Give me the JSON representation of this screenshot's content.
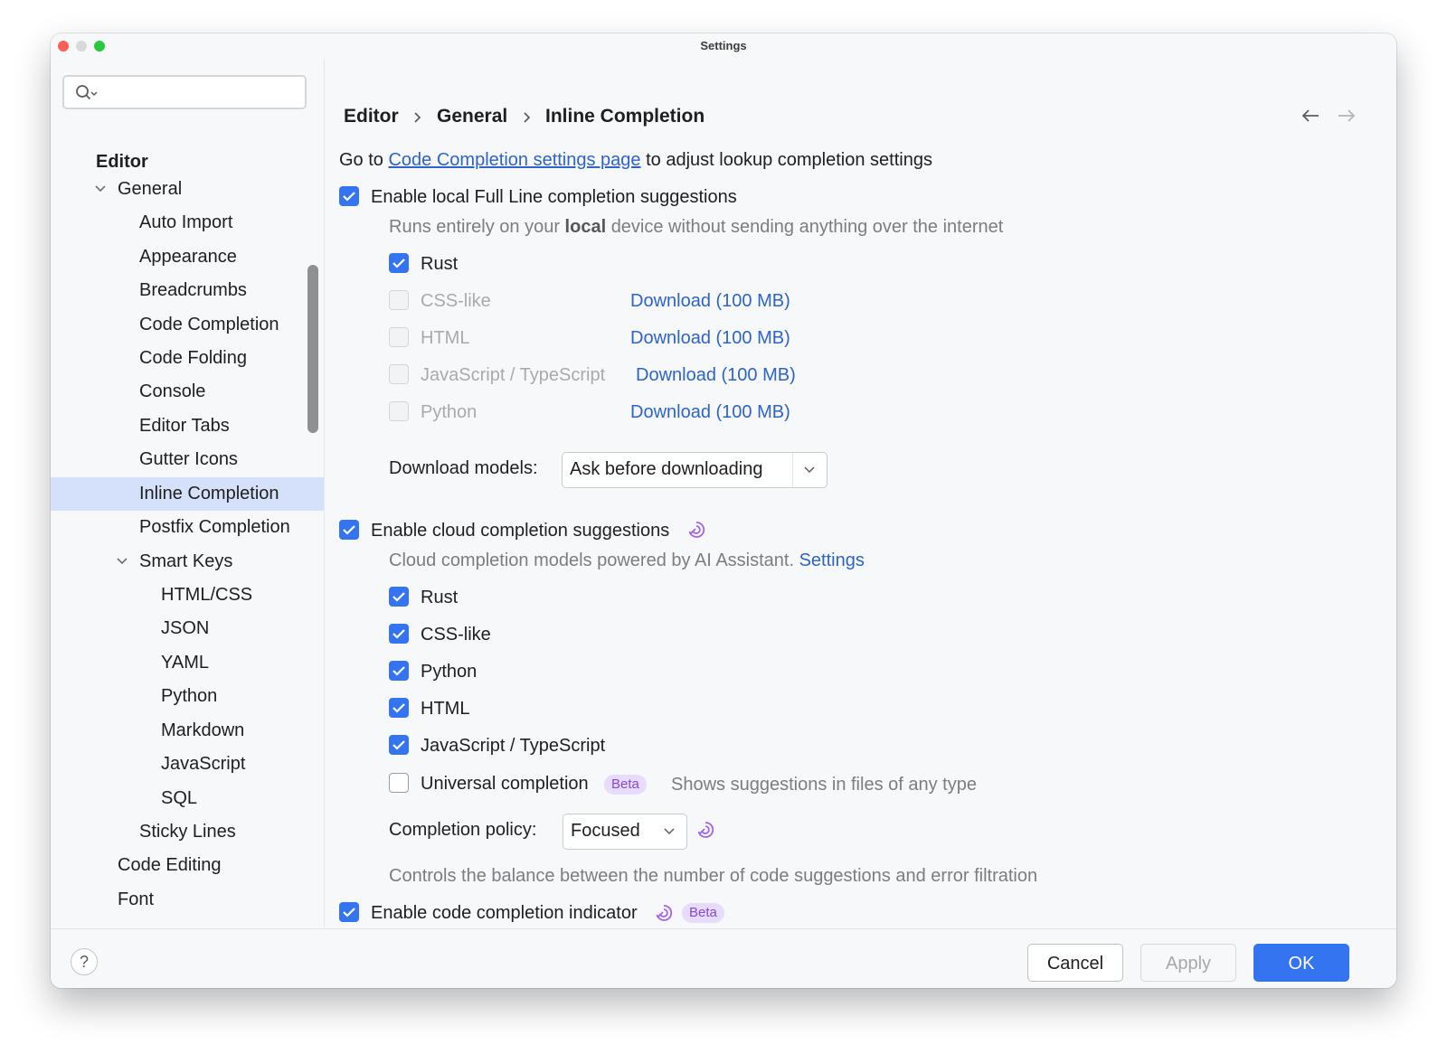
{
  "window": {
    "title": "Settings"
  },
  "search": {
    "placeholder": ""
  },
  "sidebar": {
    "items": [
      {
        "label": "Editor"
      },
      {
        "label": "General"
      },
      {
        "label": "Auto Import"
      },
      {
        "label": "Appearance"
      },
      {
        "label": "Breadcrumbs"
      },
      {
        "label": "Code Completion"
      },
      {
        "label": "Code Folding"
      },
      {
        "label": "Console"
      },
      {
        "label": "Editor Tabs"
      },
      {
        "label": "Gutter Icons"
      },
      {
        "label": "Inline Completion"
      },
      {
        "label": "Postfix Completion"
      },
      {
        "label": "Smart Keys"
      },
      {
        "label": "HTML/CSS"
      },
      {
        "label": "JSON"
      },
      {
        "label": "YAML"
      },
      {
        "label": "Python"
      },
      {
        "label": "Markdown"
      },
      {
        "label": "JavaScript"
      },
      {
        "label": "SQL"
      },
      {
        "label": "Sticky Lines"
      },
      {
        "label": "Code Editing"
      },
      {
        "label": "Font"
      }
    ]
  },
  "breadcrumb": [
    "Editor",
    "General",
    "Inline Completion"
  ],
  "main": {
    "intro": {
      "prefix": "Go to",
      "link": "Code Completion settings page",
      "suffix": "to adjust lookup completion settings"
    },
    "local": {
      "label": "Enable local Full Line completion suggestions",
      "hint_before": "Runs entirely on your",
      "hint_bold": "local",
      "hint_after": "device without sending anything over the internet",
      "languages": [
        {
          "label": "Rust",
          "download": ""
        },
        {
          "label": "CSS-like",
          "download": "Download (100 MB)"
        },
        {
          "label": "HTML",
          "download": "Download (100 MB)"
        },
        {
          "label": "JavaScript / TypeScript",
          "download": "Download (100 MB)"
        },
        {
          "label": "Python",
          "download": "Download (100 MB)"
        }
      ],
      "download_models_label": "Download models:",
      "download_models_value": "Ask before downloading"
    },
    "cloud": {
      "label": "Enable cloud completion suggestions",
      "hint": "Cloud completion models powered by AI Assistant.",
      "hint_link": "Settings",
      "languages": [
        {
          "label": "Rust"
        },
        {
          "label": "CSS-like"
        },
        {
          "label": "Python"
        },
        {
          "label": "HTML"
        },
        {
          "label": "JavaScript / TypeScript"
        }
      ],
      "universal_label": "Universal completion",
      "universal_badge": "Beta",
      "universal_hint": "Shows suggestions in files of any type",
      "policy_label": "Completion policy:",
      "policy_value": "Focused",
      "policy_hint": "Controls the balance between the number of code suggestions and error filtration"
    },
    "indicator": {
      "label": "Enable code completion indicator",
      "badge": "Beta"
    }
  },
  "footer": {
    "help": "?",
    "cancel": "Cancel",
    "apply": "Apply",
    "ok": "OK"
  },
  "colors": {
    "accent": "#3574f0",
    "link": "#2e64c7",
    "selection": "#d5e1fb",
    "ai_purple": "#8749d6"
  }
}
